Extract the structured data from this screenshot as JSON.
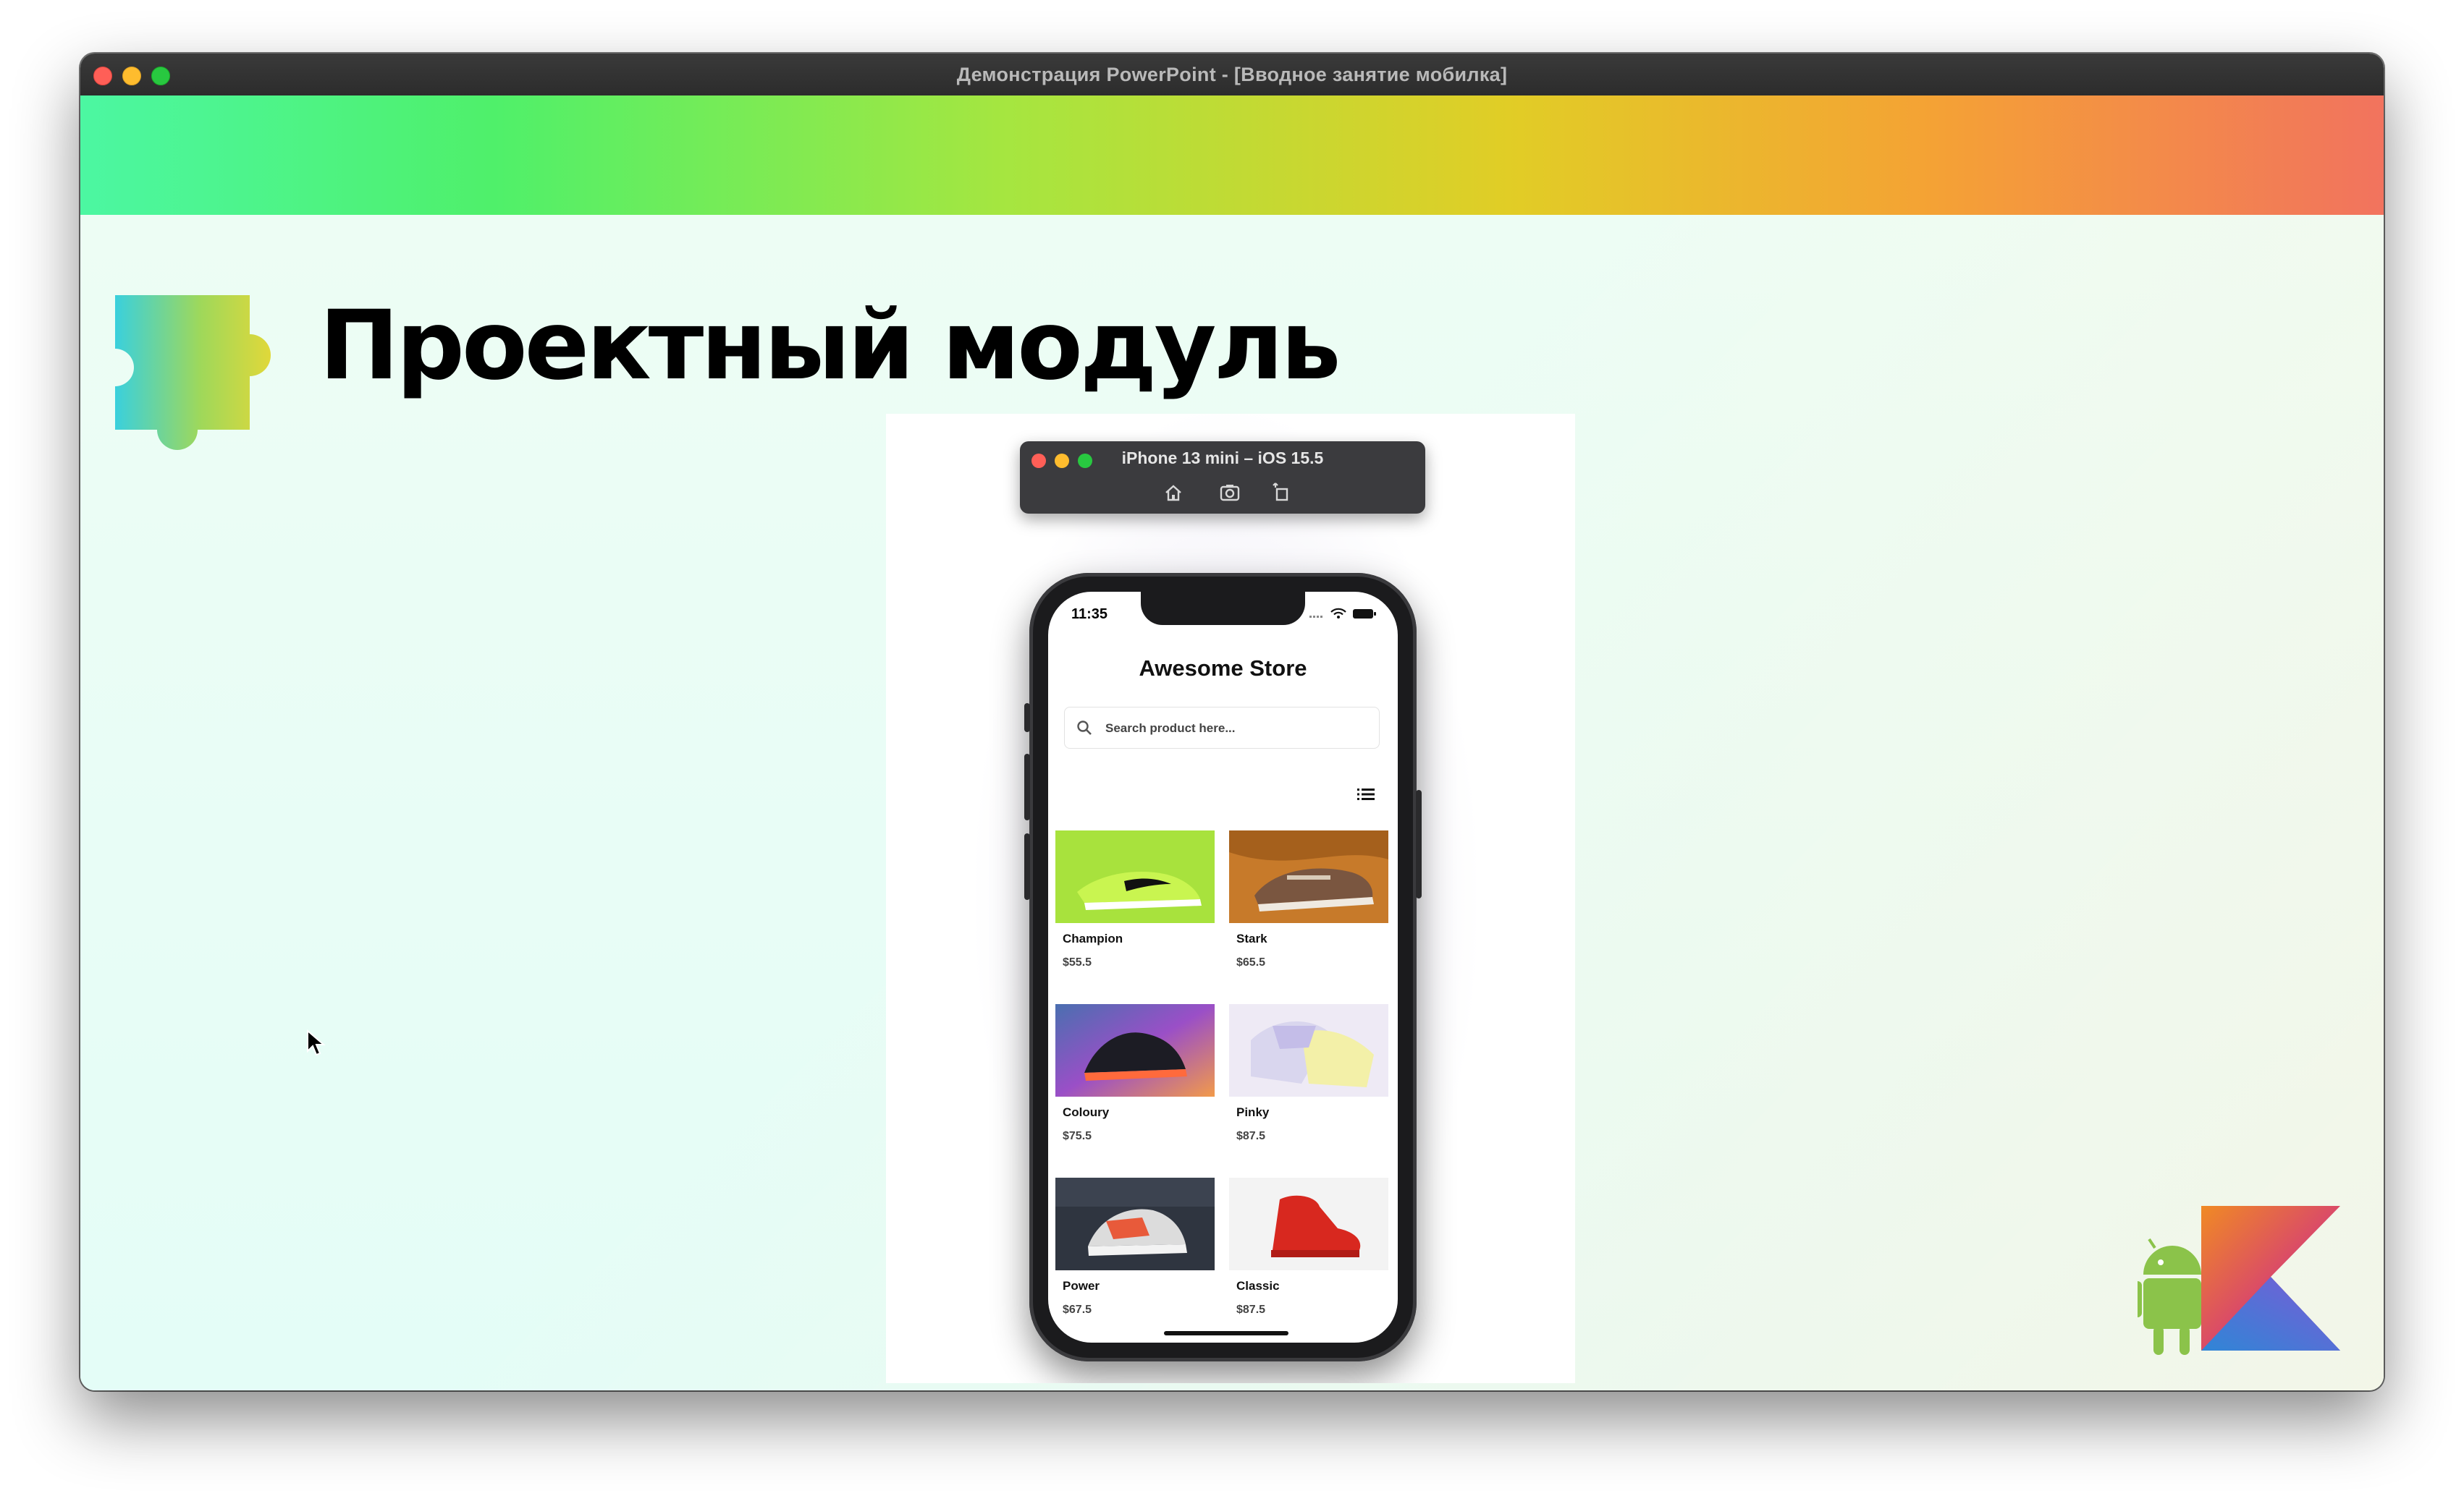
{
  "window": {
    "title": "Демонстрация PowerPoint - [Вводное занятие мобилка]"
  },
  "slide": {
    "title": "Проектный модуль",
    "icons": [
      "puzzle-piece-icon",
      "kotlin-android-logo"
    ],
    "colors": {
      "rainbow_start": "#4cf7a2",
      "rainbow_mid": "#e1cd26",
      "rainbow_end": "#f2735e",
      "kotlin_orange": "#f08a24",
      "kotlin_purple": "#7b5bd6",
      "android_green": "#8bc34a"
    }
  },
  "simulator": {
    "title": "iPhone 13 mini – iOS 15.5",
    "tools": [
      "home-icon",
      "screenshot-icon",
      "rotate-icon"
    ]
  },
  "app": {
    "status_time": "11:35",
    "store_title": "Awesome Store",
    "search_placeholder": "Search product here...",
    "products": [
      {
        "name": "Champion",
        "price": "$55.5",
        "image": "lime-green-sneaker"
      },
      {
        "name": "Stark",
        "price": "$65.5",
        "image": "brown-sneaker-on-orange"
      },
      {
        "name": "Coloury",
        "price": "$75.5",
        "image": "black-sneaker-neon-light"
      },
      {
        "name": "Pinky",
        "price": "$87.5",
        "image": "pastel-sneakers"
      },
      {
        "name": "Power",
        "price": "$67.5",
        "image": "multicolor-sneaker"
      },
      {
        "name": "Classic",
        "price": "$87.5",
        "image": "red-high-top-sneaker"
      }
    ]
  }
}
